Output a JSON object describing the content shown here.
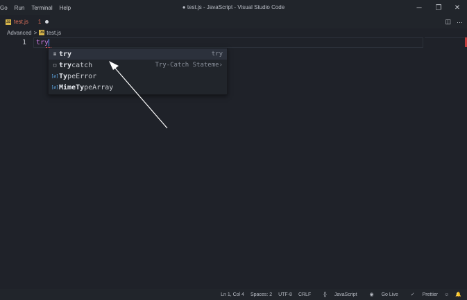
{
  "menu": [
    "Go",
    "Run",
    "Terminal",
    "Help"
  ],
  "window_title": "● test.js - JavaScript - Visual Studio Code",
  "window_controls": {
    "minimize": "─",
    "restore": "❐",
    "close": "✕"
  },
  "tab": {
    "icon": "js-file-icon",
    "name": "test.js",
    "problems": "1"
  },
  "tab_actions": {
    "split": "◫",
    "more": "···"
  },
  "breadcrumb": {
    "folder": "Advanced",
    "separator": ">",
    "file": "test.js"
  },
  "editor": {
    "line_number": "1",
    "code": "try"
  },
  "suggestions": [
    {
      "icon": "snippet-icon",
      "glyph": "≣",
      "match": "try",
      "rest": "",
      "detail": "try",
      "selected": true
    },
    {
      "icon": "snippet-box-icon",
      "glyph": "□",
      "match": "try",
      "rest": "catch",
      "detail": "Try-Catch Stateme",
      "selected": false
    },
    {
      "icon": "variable-icon",
      "glyph": "[ø]",
      "match": "Ty",
      "rest": "peError",
      "detail": "",
      "selected": false
    },
    {
      "icon": "variable-icon",
      "glyph": "[ø]",
      "match": "MimeTy",
      "rest": "peArray",
      "detail": "",
      "selected": false
    }
  ],
  "suggestion_more_glyph": "›",
  "statusbar": {
    "position": "Ln 1, Col 4",
    "spaces": "Spaces: 2",
    "encoding": "UTF-8",
    "eol": "CRLF",
    "language": "JavaScript",
    "golive": "Go Live",
    "prettier": "Prettier"
  },
  "annotation_arrow": "white arrow pointing to the trycatch suggestion"
}
